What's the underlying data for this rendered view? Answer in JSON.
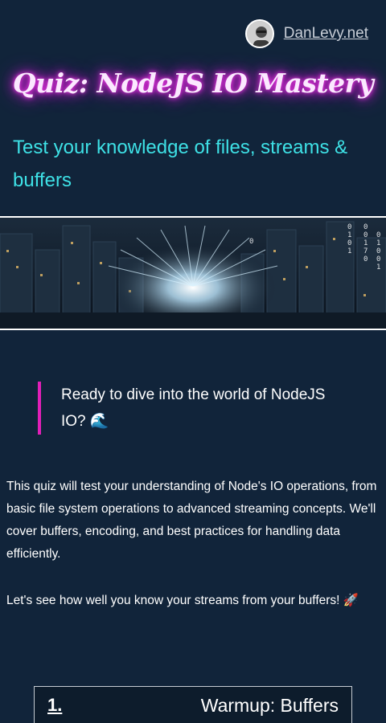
{
  "header": {
    "site_link": "DanLevy.net",
    "avatar_icon": "avatar-icon"
  },
  "hero": {
    "title": "Quiz: NodeJS IO Mastery",
    "subtitle": "Test your knowledge of files, streams & buffers"
  },
  "banner": {
    "icon": "banner-image",
    "binary_digits": [
      "0",
      "0",
      "1",
      "0",
      "1",
      "0",
      "0",
      "1",
      "7",
      "0",
      "0",
      "1",
      "0",
      "0",
      "1"
    ]
  },
  "intro": {
    "callout": "Ready to dive into the world of NodeJS IO? 🌊",
    "paragraph_1": "This quiz will test your understanding of Node's IO operations, from basic file system operations to advanced streaming concepts. We'll cover buffers, encoding, and best practices for handling data efficiently.",
    "paragraph_2": "Let's see how well you know your streams from your buffers! 🚀"
  },
  "questions": [
    {
      "number": "1.",
      "title": "Warmup: Buffers"
    }
  ],
  "colors": {
    "background": "#11243a",
    "title_glow": "#e41fe0",
    "subtitle": "#3ee1e6",
    "callout_border": "#e21fb8"
  }
}
